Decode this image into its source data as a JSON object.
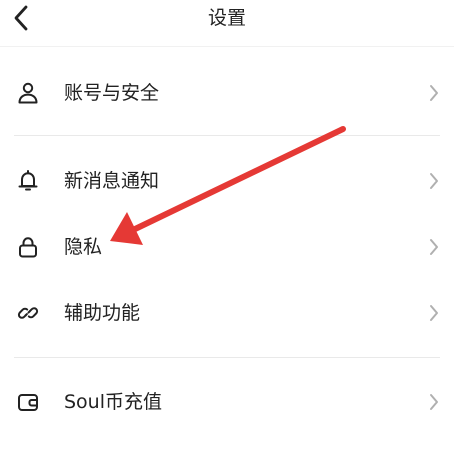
{
  "header": {
    "title": "设置",
    "back_icon": "chevron-left-icon"
  },
  "settings": {
    "items": [
      {
        "label": "账号与安全",
        "icon": "user-icon"
      },
      {
        "label": "新消息通知",
        "icon": "bell-icon"
      },
      {
        "label": "隐私",
        "icon": "lock-icon"
      },
      {
        "label": "辅助功能",
        "icon": "link-icon"
      },
      {
        "label": "Soul币充值",
        "icon": "wallet-icon"
      }
    ]
  },
  "annotation": {
    "arrow_color": "#e53935"
  },
  "colors": {
    "text": "#222222",
    "chevron": "#b0b0b0",
    "divider": "#e9e9e9"
  }
}
